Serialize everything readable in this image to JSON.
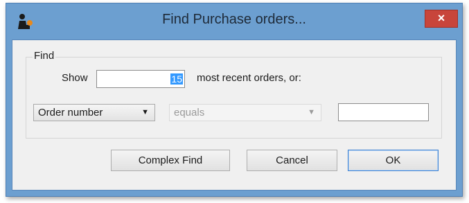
{
  "window": {
    "title": "Find Purchase orders...",
    "close_glyph": "×"
  },
  "find_group": {
    "label": "Find"
  },
  "recent": {
    "show_label": "Show",
    "count": "15",
    "suffix": "most recent orders, or:"
  },
  "criteria": {
    "field_selected": "Order number",
    "operator_selected": "equals",
    "value": ""
  },
  "buttons": {
    "complex_find": "Complex Find",
    "cancel": "Cancel",
    "ok": "OK"
  },
  "icons": {
    "app": "mobile-supply-app-icon",
    "close": "close-icon",
    "dropdown": "chevron-down-icon"
  },
  "colors": {
    "frame": "#6c9fd0",
    "close": "#c8453b",
    "default_button_border": "#3c7fd1"
  }
}
